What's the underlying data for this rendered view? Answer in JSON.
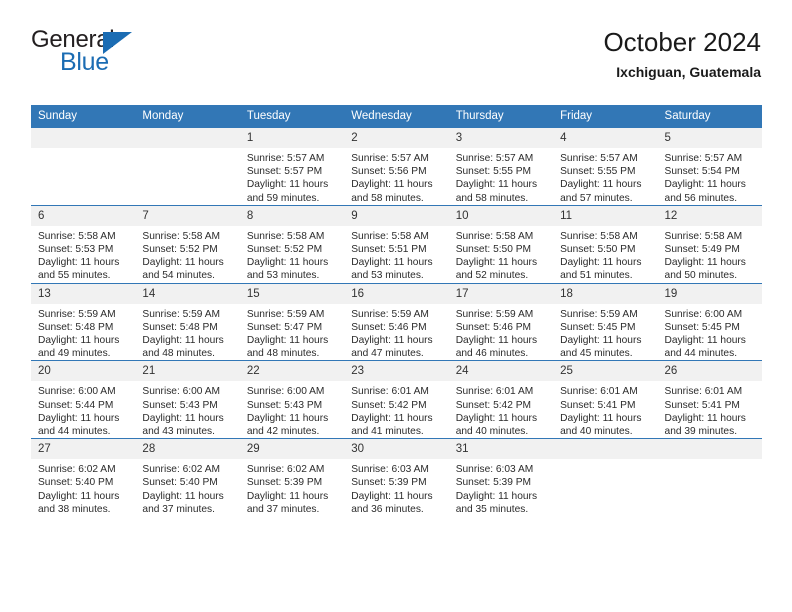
{
  "brand": {
    "name_top": "General",
    "name_bottom": "Blue",
    "triangle_color": "#1b6cb3",
    "text_color": "#231f20"
  },
  "header": {
    "title": "October 2024",
    "subtitle": "Ixchiguan, Guatemala",
    "header_bg": "#3277b6",
    "header_text": "#ffffff",
    "daynum_bg": "#f1f1f1",
    "row_border": "#3277b6"
  },
  "weekdays": [
    "Sunday",
    "Monday",
    "Tuesday",
    "Wednesday",
    "Thursday",
    "Friday",
    "Saturday"
  ],
  "weeks": [
    [
      {
        "day": "",
        "sunrise": "",
        "sunset": "",
        "daylight": ""
      },
      {
        "day": "",
        "sunrise": "",
        "sunset": "",
        "daylight": ""
      },
      {
        "day": "1",
        "sunrise": "Sunrise: 5:57 AM",
        "sunset": "Sunset: 5:57 PM",
        "daylight": "Daylight: 11 hours and 59 minutes."
      },
      {
        "day": "2",
        "sunrise": "Sunrise: 5:57 AM",
        "sunset": "Sunset: 5:56 PM",
        "daylight": "Daylight: 11 hours and 58 minutes."
      },
      {
        "day": "3",
        "sunrise": "Sunrise: 5:57 AM",
        "sunset": "Sunset: 5:55 PM",
        "daylight": "Daylight: 11 hours and 58 minutes."
      },
      {
        "day": "4",
        "sunrise": "Sunrise: 5:57 AM",
        "sunset": "Sunset: 5:55 PM",
        "daylight": "Daylight: 11 hours and 57 minutes."
      },
      {
        "day": "5",
        "sunrise": "Sunrise: 5:57 AM",
        "sunset": "Sunset: 5:54 PM",
        "daylight": "Daylight: 11 hours and 56 minutes."
      }
    ],
    [
      {
        "day": "6",
        "sunrise": "Sunrise: 5:58 AM",
        "sunset": "Sunset: 5:53 PM",
        "daylight": "Daylight: 11 hours and 55 minutes."
      },
      {
        "day": "7",
        "sunrise": "Sunrise: 5:58 AM",
        "sunset": "Sunset: 5:52 PM",
        "daylight": "Daylight: 11 hours and 54 minutes."
      },
      {
        "day": "8",
        "sunrise": "Sunrise: 5:58 AM",
        "sunset": "Sunset: 5:52 PM",
        "daylight": "Daylight: 11 hours and 53 minutes."
      },
      {
        "day": "9",
        "sunrise": "Sunrise: 5:58 AM",
        "sunset": "Sunset: 5:51 PM",
        "daylight": "Daylight: 11 hours and 53 minutes."
      },
      {
        "day": "10",
        "sunrise": "Sunrise: 5:58 AM",
        "sunset": "Sunset: 5:50 PM",
        "daylight": "Daylight: 11 hours and 52 minutes."
      },
      {
        "day": "11",
        "sunrise": "Sunrise: 5:58 AM",
        "sunset": "Sunset: 5:50 PM",
        "daylight": "Daylight: 11 hours and 51 minutes."
      },
      {
        "day": "12",
        "sunrise": "Sunrise: 5:58 AM",
        "sunset": "Sunset: 5:49 PM",
        "daylight": "Daylight: 11 hours and 50 minutes."
      }
    ],
    [
      {
        "day": "13",
        "sunrise": "Sunrise: 5:59 AM",
        "sunset": "Sunset: 5:48 PM",
        "daylight": "Daylight: 11 hours and 49 minutes."
      },
      {
        "day": "14",
        "sunrise": "Sunrise: 5:59 AM",
        "sunset": "Sunset: 5:48 PM",
        "daylight": "Daylight: 11 hours and 48 minutes."
      },
      {
        "day": "15",
        "sunrise": "Sunrise: 5:59 AM",
        "sunset": "Sunset: 5:47 PM",
        "daylight": "Daylight: 11 hours and 48 minutes."
      },
      {
        "day": "16",
        "sunrise": "Sunrise: 5:59 AM",
        "sunset": "Sunset: 5:46 PM",
        "daylight": "Daylight: 11 hours and 47 minutes."
      },
      {
        "day": "17",
        "sunrise": "Sunrise: 5:59 AM",
        "sunset": "Sunset: 5:46 PM",
        "daylight": "Daylight: 11 hours and 46 minutes."
      },
      {
        "day": "18",
        "sunrise": "Sunrise: 5:59 AM",
        "sunset": "Sunset: 5:45 PM",
        "daylight": "Daylight: 11 hours and 45 minutes."
      },
      {
        "day": "19",
        "sunrise": "Sunrise: 6:00 AM",
        "sunset": "Sunset: 5:45 PM",
        "daylight": "Daylight: 11 hours and 44 minutes."
      }
    ],
    [
      {
        "day": "20",
        "sunrise": "Sunrise: 6:00 AM",
        "sunset": "Sunset: 5:44 PM",
        "daylight": "Daylight: 11 hours and 44 minutes."
      },
      {
        "day": "21",
        "sunrise": "Sunrise: 6:00 AM",
        "sunset": "Sunset: 5:43 PM",
        "daylight": "Daylight: 11 hours and 43 minutes."
      },
      {
        "day": "22",
        "sunrise": "Sunrise: 6:00 AM",
        "sunset": "Sunset: 5:43 PM",
        "daylight": "Daylight: 11 hours and 42 minutes."
      },
      {
        "day": "23",
        "sunrise": "Sunrise: 6:01 AM",
        "sunset": "Sunset: 5:42 PM",
        "daylight": "Daylight: 11 hours and 41 minutes."
      },
      {
        "day": "24",
        "sunrise": "Sunrise: 6:01 AM",
        "sunset": "Sunset: 5:42 PM",
        "daylight": "Daylight: 11 hours and 40 minutes."
      },
      {
        "day": "25",
        "sunrise": "Sunrise: 6:01 AM",
        "sunset": "Sunset: 5:41 PM",
        "daylight": "Daylight: 11 hours and 40 minutes."
      },
      {
        "day": "26",
        "sunrise": "Sunrise: 6:01 AM",
        "sunset": "Sunset: 5:41 PM",
        "daylight": "Daylight: 11 hours and 39 minutes."
      }
    ],
    [
      {
        "day": "27",
        "sunrise": "Sunrise: 6:02 AM",
        "sunset": "Sunset: 5:40 PM",
        "daylight": "Daylight: 11 hours and 38 minutes."
      },
      {
        "day": "28",
        "sunrise": "Sunrise: 6:02 AM",
        "sunset": "Sunset: 5:40 PM",
        "daylight": "Daylight: 11 hours and 37 minutes."
      },
      {
        "day": "29",
        "sunrise": "Sunrise: 6:02 AM",
        "sunset": "Sunset: 5:39 PM",
        "daylight": "Daylight: 11 hours and 37 minutes."
      },
      {
        "day": "30",
        "sunrise": "Sunrise: 6:03 AM",
        "sunset": "Sunset: 5:39 PM",
        "daylight": "Daylight: 11 hours and 36 minutes."
      },
      {
        "day": "31",
        "sunrise": "Sunrise: 6:03 AM",
        "sunset": "Sunset: 5:39 PM",
        "daylight": "Daylight: 11 hours and 35 minutes."
      },
      {
        "day": "",
        "sunrise": "",
        "sunset": "",
        "daylight": ""
      },
      {
        "day": "",
        "sunrise": "",
        "sunset": "",
        "daylight": ""
      }
    ]
  ]
}
